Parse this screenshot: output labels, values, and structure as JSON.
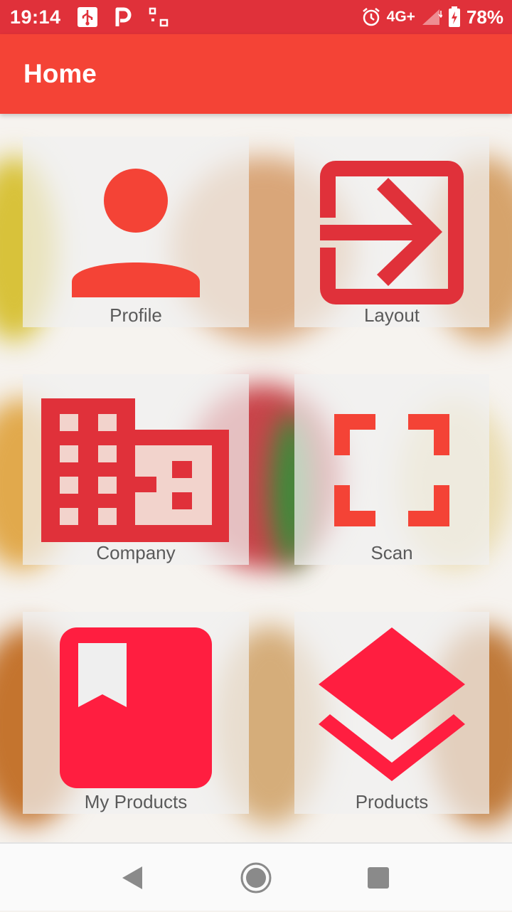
{
  "status_bar": {
    "time": "19:14",
    "network": "4G+",
    "battery": "78%",
    "icons": [
      "usb-icon",
      "p-notification-icon",
      "screen-cast-icon",
      "alarm-icon",
      "signal-icon",
      "battery-charging-icon"
    ]
  },
  "app_bar": {
    "title": "Home"
  },
  "tiles": [
    {
      "label": "Profile",
      "icon": "person-icon",
      "color": "#f44336"
    },
    {
      "label": "Layout",
      "icon": "login-arrow-icon",
      "color": "#e0313a"
    },
    {
      "label": "Company",
      "icon": "building-icon",
      "color": "#e0313a"
    },
    {
      "label": "Scan",
      "icon": "scan-frame-icon",
      "color": "#f44336"
    },
    {
      "label": "My Products",
      "icon": "bookmark-book-icon",
      "color": "#ff1e40"
    },
    {
      "label": "Products",
      "icon": "layers-icon",
      "color": "#ff1e40"
    }
  ],
  "nav_bar": {
    "icons": [
      "back-icon",
      "home-icon",
      "recents-icon"
    ]
  },
  "colors": {
    "status_bar": "#e0313a",
    "app_bar": "#f44336",
    "nav_icon": "#8a8a8a"
  }
}
